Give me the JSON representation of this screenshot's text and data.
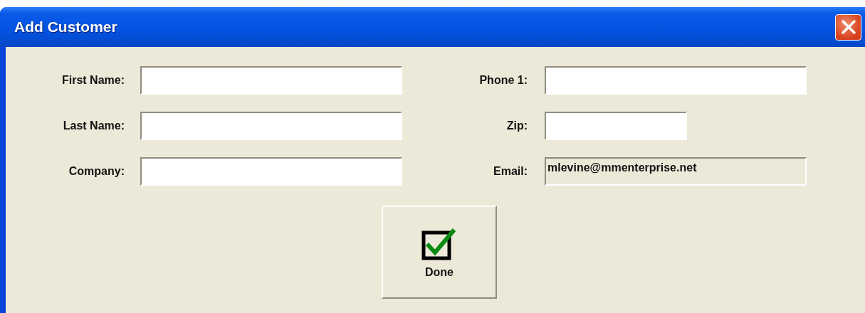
{
  "window": {
    "title": "Add Customer"
  },
  "left_fields": [
    {
      "label": "First Name:",
      "disabled": false
    },
    {
      "label": "Last Name:",
      "disabled": false
    },
    {
      "label": "Company:",
      "disabled": false
    }
  ],
  "right_fields": [
    {
      "label": "Phone 1:",
      "disabled": false
    },
    {
      "label": "Zip:",
      "disabled": false
    },
    {
      "label": "Email:",
      "value": "mlevine@mmenterprise.net",
      "disabled": true
    }
  ],
  "buttons": [
    {
      "label": "Done"
    }
  ]
}
